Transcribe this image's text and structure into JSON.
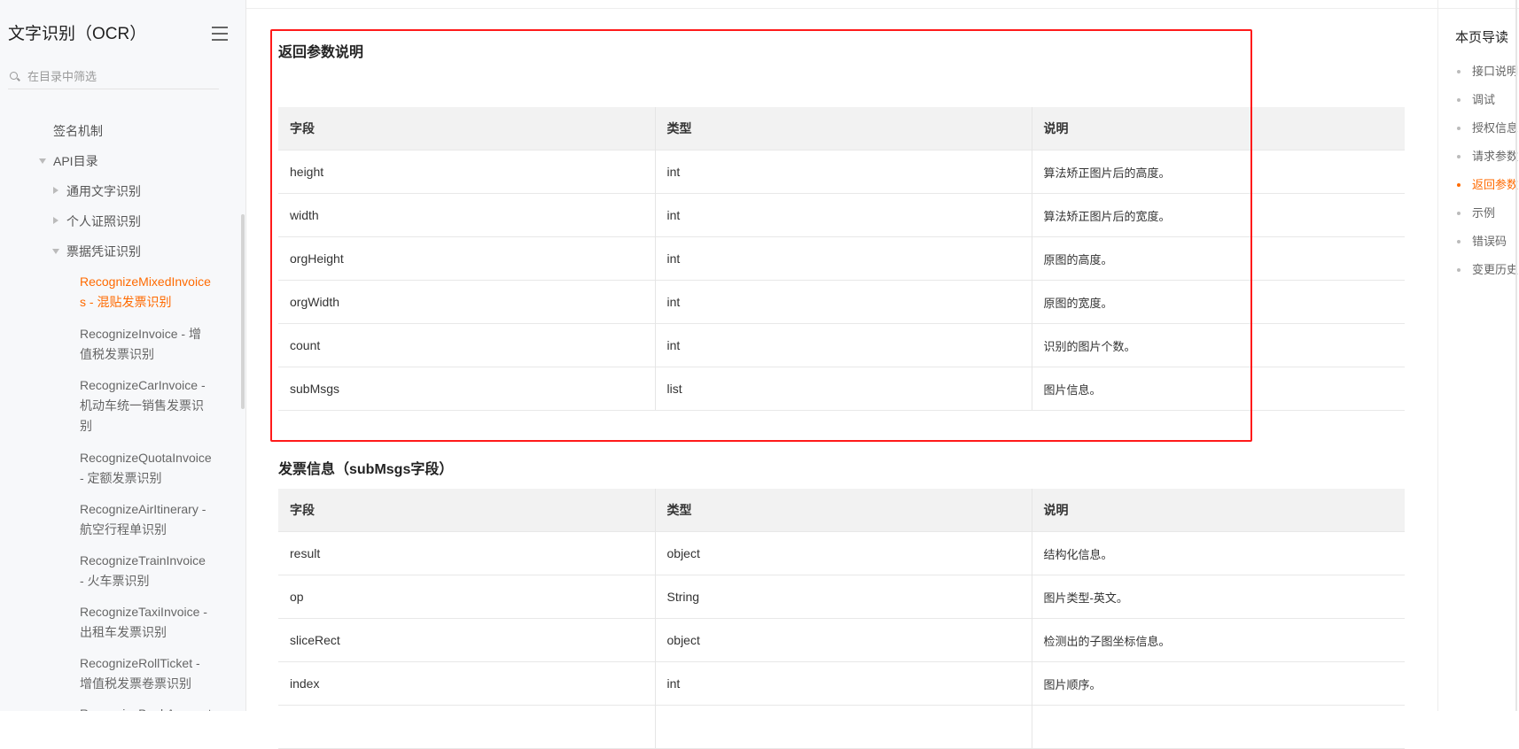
{
  "sidebar": {
    "title": "文字识别（OCR）",
    "search_placeholder": "在目录中筛选",
    "nav": [
      {
        "label": "签名机制"
      },
      {
        "label": "API目录"
      },
      {
        "label": "通用文字识别"
      },
      {
        "label": "个人证照识别"
      },
      {
        "label": "票据凭证识别"
      }
    ],
    "sub_items": [
      {
        "line1": "RecognizeMixedInvoice",
        "line2": "s - 混贴发票识别",
        "active": true
      },
      {
        "line1": "RecognizeInvoice - 增",
        "line2": "值税发票识别"
      },
      {
        "line1": "RecognizeCarInvoice -",
        "line2": "机动车统一销售发票识",
        "line3": "别"
      },
      {
        "line1": "RecognizeQuotaInvoice",
        "line2": "- 定额发票识别"
      },
      {
        "line1": "RecognizeAirItinerary -",
        "line2": "航空行程单识别"
      },
      {
        "line1": "RecognizeTrainInvoice",
        "line2": "- 火车票识别"
      },
      {
        "line1": "RecognizeTaxiInvoice -",
        "line2": "出租车发票识别"
      },
      {
        "line1": "RecognizeRollTicket -",
        "line2": "增值税发票卷票识别"
      },
      {
        "line1": "RecognizeBankAccount"
      }
    ]
  },
  "main": {
    "section1": {
      "title": "返回参数说明",
      "headers": [
        "字段",
        "类型",
        "说明"
      ],
      "rows": [
        [
          "height",
          "int",
          "算法矫正图片后的高度。"
        ],
        [
          "width",
          "int",
          "算法矫正图片后的宽度。"
        ],
        [
          "orgHeight",
          "int",
          "原图的高度。"
        ],
        [
          "orgWidth",
          "int",
          "原图的宽度。"
        ],
        [
          "count",
          "int",
          "识别的图片个数。"
        ],
        [
          "subMsgs",
          "list",
          "图片信息。"
        ]
      ]
    },
    "section2": {
      "title": "发票信息（subMsgs字段）",
      "headers": [
        "字段",
        "类型",
        "说明"
      ],
      "rows": [
        [
          "result",
          "object",
          "结构化信息。"
        ],
        [
          "op",
          "String",
          "图片类型-英文。"
        ],
        [
          "sliceRect",
          "object",
          "检测出的子图坐标信息。"
        ],
        [
          "index",
          "int",
          "图片顺序。"
        ],
        [
          "",
          "",
          ""
        ]
      ]
    }
  },
  "toc": {
    "title": "本页导读",
    "items": [
      {
        "label": "接口说明"
      },
      {
        "label": "调试"
      },
      {
        "label": "授权信息"
      },
      {
        "label": "请求参数"
      },
      {
        "label": "返回参数",
        "active": true
      },
      {
        "label": "示例"
      },
      {
        "label": "错误码"
      },
      {
        "label": "变更历史"
      }
    ]
  },
  "colors": {
    "accent": "#ff6a00",
    "highlight_border": "#ff1a1a",
    "table_header_bg": "#f2f2f2",
    "sidebar_bg": "#f7f8fa"
  }
}
